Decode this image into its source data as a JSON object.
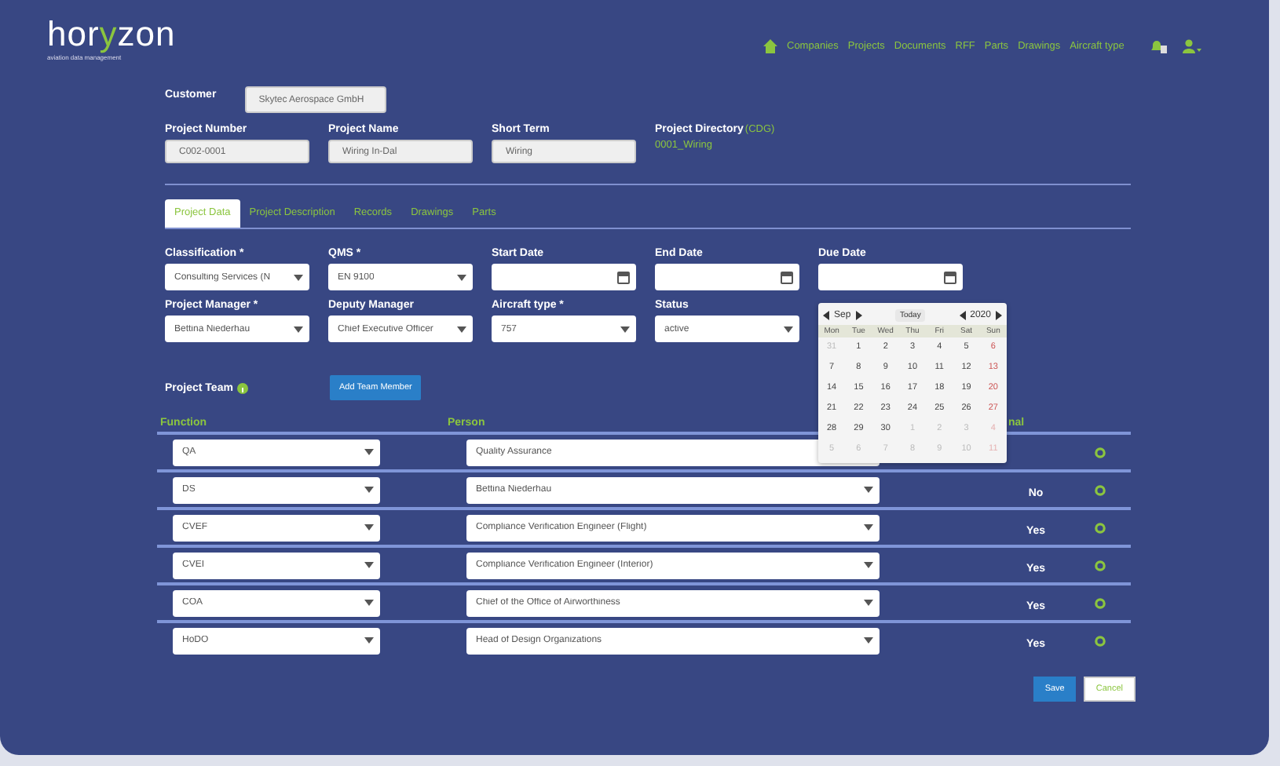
{
  "header": {
    "logo": [
      "hor",
      "y",
      "zon"
    ],
    "tagline": "aviation data management",
    "nav": [
      "Companies",
      "Projects",
      "Documents",
      "RFF",
      "Parts",
      "Drawings",
      "Aircraft type"
    ]
  },
  "customer": {
    "label": "Customer",
    "value": "Skytec Aerospace GmbH"
  },
  "project_fields": [
    {
      "kind": "input",
      "label": "Project Number",
      "value": "C002-0001"
    },
    {
      "kind": "input",
      "label": "Project Name",
      "value": "Wiring In-Dal"
    },
    {
      "kind": "input",
      "label": "Short Term",
      "value": "Wiring"
    },
    {
      "kind": "directory",
      "label": "Project Directory",
      "note": "(CDG)",
      "value": "0001_Wiring"
    }
  ],
  "tabs": [
    {
      "label": "Project Data",
      "selected": true
    },
    {
      "label": "Project Description",
      "selected": false
    },
    {
      "label": "Records",
      "selected": false
    },
    {
      "label": "Drawings",
      "selected": false
    },
    {
      "label": "Parts",
      "selected": false
    }
  ],
  "form_rows": [
    [
      {
        "kind": "select",
        "label": "Classification *",
        "value": "Consulting Services (N"
      },
      {
        "kind": "select",
        "label": "QMS *",
        "value": "EN 9100"
      },
      {
        "kind": "date",
        "label": "Start Date"
      },
      {
        "kind": "date",
        "label": "End Date"
      },
      {
        "kind": "date",
        "label": "Due Date"
      }
    ],
    [
      {
        "kind": "select",
        "label": "Project Manager *",
        "value": "Bettina Niederhau"
      },
      {
        "kind": "select",
        "label": "Deputy Manager",
        "value": "Chief Executive Officer"
      },
      {
        "kind": "select",
        "label": "Aircraft type *",
        "value": "757"
      },
      {
        "kind": "select",
        "label": "Status",
        "value": "active"
      }
    ]
  ],
  "team": {
    "label": "Project Team",
    "add_button": "Add Team Member",
    "columns": [
      "Function",
      "Person",
      "nal"
    ],
    "rows": [
      {
        "function": "QA",
        "person": "Quality Assurance"
      },
      {
        "function": "DS",
        "person": "Bettina Niederhau",
        "value": "No"
      },
      {
        "function": "CVEF",
        "person": "Compliance Verification Engineer (Flight)",
        "value": "Yes"
      },
      {
        "function": "CVEI",
        "person": "Compliance Verification Engineer (Interior)",
        "value": "Yes"
      },
      {
        "function": "COA",
        "person": "Chief of the Office of Airworthiness",
        "value": "Yes"
      },
      {
        "function": "HoDO",
        "person": "Head of Design Organizations",
        "value": "Yes"
      }
    ]
  },
  "calendar": {
    "month": "Sep",
    "today": "Today",
    "year": "2020",
    "weekdays": [
      "Mon",
      "Tue",
      "Wed",
      "Thu",
      "Fri",
      "Sat",
      "Sun"
    ],
    "weeks": [
      [
        {
          "day": "31",
          "outside": true
        },
        {
          "day": "1",
          "outside": false
        },
        {
          "day": "2",
          "outside": false
        },
        {
          "day": "3",
          "outside": false
        },
        {
          "day": "4",
          "outside": false
        },
        {
          "day": "5",
          "outside": false
        },
        {
          "day": "6",
          "outside": false
        }
      ],
      [
        {
          "day": "7",
          "outside": false
        },
        {
          "day": "8",
          "outside": false
        },
        {
          "day": "9",
          "outside": false
        },
        {
          "day": "10",
          "outside": false
        },
        {
          "day": "11",
          "outside": false
        },
        {
          "day": "12",
          "outside": false
        },
        {
          "day": "13",
          "outside": false
        }
      ],
      [
        {
          "day": "14",
          "outside": false
        },
        {
          "day": "15",
          "outside": false
        },
        {
          "day": "16",
          "outside": false
        },
        {
          "day": "17",
          "outside": false
        },
        {
          "day": "18",
          "outside": false
        },
        {
          "day": "19",
          "outside": false
        },
        {
          "day": "20",
          "outside": false
        }
      ],
      [
        {
          "day": "21",
          "outside": false
        },
        {
          "day": "22",
          "outside": false
        },
        {
          "day": "23",
          "outside": false
        },
        {
          "day": "24",
          "outside": false
        },
        {
          "day": "25",
          "outside": false
        },
        {
          "day": "26",
          "outside": false
        },
        {
          "day": "27",
          "outside": false
        }
      ],
      [
        {
          "day": "28",
          "outside": false
        },
        {
          "day": "29",
          "outside": false
        },
        {
          "day": "30",
          "outside": false
        },
        {
          "day": "1",
          "outside": true
        },
        {
          "day": "2",
          "outside": true
        },
        {
          "day": "3",
          "outside": true
        },
        {
          "day": "4",
          "outside": true
        }
      ],
      [
        {
          "day": "5",
          "outside": true
        },
        {
          "day": "6",
          "outside": true
        },
        {
          "day": "7",
          "outside": true
        },
        {
          "day": "8",
          "outside": true
        },
        {
          "day": "9",
          "outside": true
        },
        {
          "day": "10",
          "outside": true
        },
        {
          "day": "11",
          "outside": true
        }
      ]
    ]
  },
  "actions": {
    "save": "Save",
    "cancel": "Cancel"
  }
}
